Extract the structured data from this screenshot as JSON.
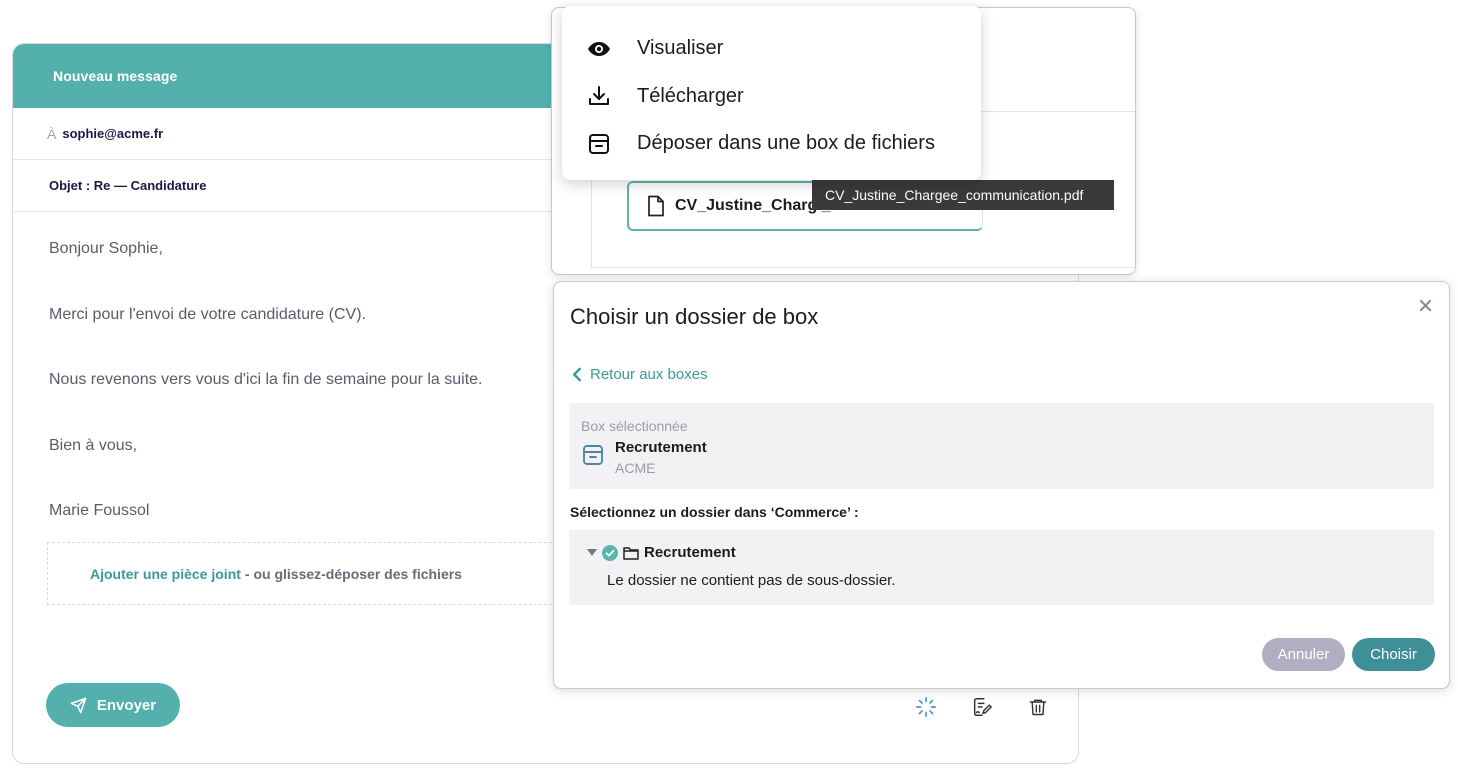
{
  "compose": {
    "title": "Nouveau message",
    "to_prefix": "À",
    "to_value": "sophie@acme.fr",
    "subject": "Objet : Re — Candidature",
    "body": [
      "Bonjour Sophie,",
      "Merci pour l'envoi de votre candidature (CV).",
      "Nous revenons vers vous d'ici la fin de semaine pour la suite.",
      "Bien à vous,",
      "Marie Foussol"
    ],
    "attach_link": "Ajouter une pièce joint",
    "attach_rest": "- ou glissez-déposer des fichiers",
    "send_label": "Envoyer"
  },
  "file_panel": {
    "chip_name": "CV_Justine_Charg _om.docx",
    "tooltip": "CV_Justine_Chargee_communication.pdf"
  },
  "menu": {
    "items": [
      {
        "label": "Visualiser",
        "icon": "eye-icon"
      },
      {
        "label": "Télécharger",
        "icon": "download-icon"
      },
      {
        "label": "Déposer dans une box de fichiers",
        "icon": "archive-box-icon"
      }
    ]
  },
  "modal": {
    "title": "Choisir un dossier de box",
    "back_label": "Retour aux boxes",
    "selected_caption": "Box sélectionnée",
    "selected_name": "Recrutement",
    "selected_org": "ACME",
    "prompt": "Sélectionnez un dossier dans ‘Commerce’ :",
    "folder_name": "Recrutement",
    "folder_empty": "Le dossier ne contient pas de sous-dossier.",
    "cancel_label": "Annuler",
    "choose_label": "Choisir"
  },
  "colors": {
    "accent": "#54b0ac",
    "accent_dark": "#3e8f96",
    "link": "#3a9a98",
    "muted_button": "#b0aec0"
  }
}
